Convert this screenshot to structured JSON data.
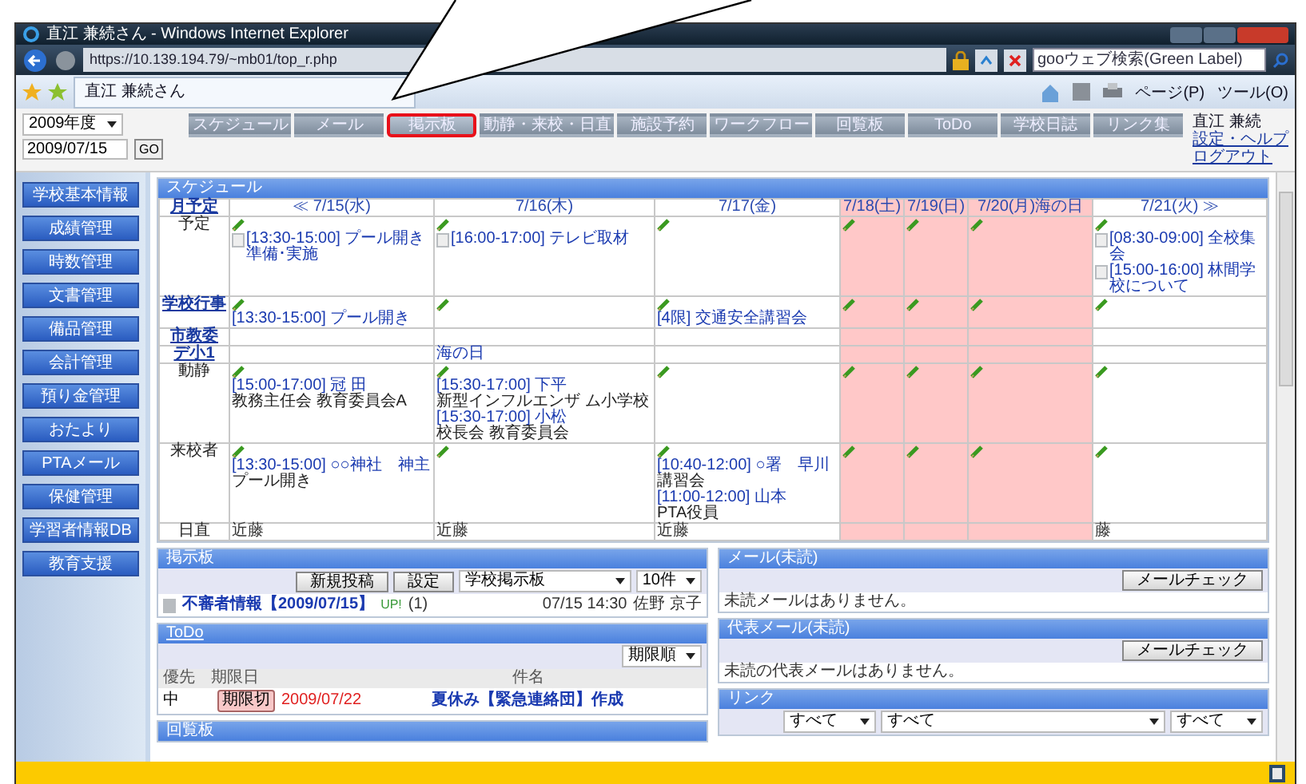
{
  "window": {
    "title": "直江 兼続さん - Windows Internet Explorer"
  },
  "address": "https://10.139.194.79/~mb01/top_r.php",
  "search": {
    "placeholder": "gooウェブ検索(Green Label)"
  },
  "tab": {
    "label": "直江 兼続さん"
  },
  "commands": [
    "ページ(P)",
    "ツール(O)"
  ],
  "year": "2009年度",
  "date": "2009/07/15",
  "go": "GO",
  "nav": [
    {
      "label": "スケジュール",
      "selected": false
    },
    {
      "label": "メール",
      "selected": false
    },
    {
      "label": "掲示板",
      "selected": true
    },
    {
      "label": "動静・来校・日直",
      "selected": false
    },
    {
      "label": "施設予約",
      "selected": false
    },
    {
      "label": "ワークフロー",
      "selected": false
    },
    {
      "label": "回覧板",
      "selected": false
    },
    {
      "label": "ToDo",
      "selected": false
    },
    {
      "label": "学校日誌",
      "selected": false
    },
    {
      "label": "リンク集",
      "selected": false
    }
  ],
  "user": {
    "name": "直江 兼続",
    "links": [
      "設定・ヘルプ",
      "ログアウト"
    ]
  },
  "sidebar": [
    "学校基本情報",
    "成績管理",
    "時数管理",
    "文書管理",
    "備品管理",
    "会計管理",
    "預り金管理",
    "おたより",
    "PTAメール",
    "保健管理",
    "学習者情報DB",
    "教育支援"
  ],
  "schedule": {
    "title": "スケジュール",
    "corner": "月予定",
    "columns": [
      {
        "label": "≪ 7/15(水)",
        "holiday": false
      },
      {
        "label": "7/16(木)",
        "holiday": false
      },
      {
        "label": "7/17(金)",
        "holiday": false
      },
      {
        "label": "7/18(土)",
        "holiday": true
      },
      {
        "label": "7/19(日)",
        "holiday": true
      },
      {
        "label": "7/20(月)海の日",
        "holiday": true
      },
      {
        "label": "7/21(火) ≫",
        "holiday": false
      }
    ],
    "rows": [
      {
        "label": "予定",
        "link": false,
        "cells": [
          {
            "pencil": true,
            "items": [
              {
                "kind": "event",
                "text": "[13:30-15:00] プール開き準備･実施"
              }
            ]
          },
          {
            "pencil": true,
            "items": [
              {
                "kind": "event",
                "text": "[16:00-17:00] テレビ取材"
              }
            ]
          },
          {
            "pencil": true
          },
          {
            "pencil": true
          },
          {
            "pencil": true
          },
          {
            "pencil": true
          },
          {
            "pencil": true,
            "items": [
              {
                "kind": "event",
                "text": "[08:30-09:00] 全校集会"
              },
              {
                "kind": "event",
                "text": "[15:00-16:00] 林間学校について"
              }
            ]
          }
        ]
      },
      {
        "label": "学校行事",
        "link": true,
        "cells": [
          {
            "pencil": true,
            "items": [
              {
                "kind": "entry",
                "text": "[13:30-15:00] プール開き"
              }
            ]
          },
          {
            "pencil": true
          },
          {
            "pencil": true,
            "items": [
              {
                "kind": "entry",
                "text": "[4限] 交通安全講習会"
              }
            ]
          },
          {
            "pencil": true
          },
          {
            "pencil": true
          },
          {
            "pencil": true
          },
          {
            "pencil": true
          }
        ]
      },
      {
        "label": "市教委",
        "link": true,
        "cells": [
          {
            "pencil": false
          },
          {
            "pencil": false
          },
          {
            "pencil": false
          },
          {
            "pencil": false
          },
          {
            "pencil": false
          },
          {
            "pencil": false
          },
          {
            "pencil": false
          }
        ]
      },
      {
        "label": "デ小1",
        "link": true,
        "cells": [
          {
            "pencil": false
          },
          {
            "pencil": false,
            "items": [
              {
                "kind": "entry",
                "text": "海の日"
              }
            ]
          },
          {
            "pencil": false
          },
          {
            "pencil": false
          },
          {
            "pencil": false
          },
          {
            "pencil": false
          },
          {
            "pencil": false
          }
        ]
      },
      {
        "label": "動静",
        "link": false,
        "cells": [
          {
            "pencil": true,
            "items": [
              {
                "kind": "entry",
                "text": "[15:00-17:00] 冠 田",
                "sub": "教務主任会 教育委員会A"
              }
            ]
          },
          {
            "pencil": true,
            "items": [
              {
                "kind": "entry",
                "text": "[15:30-17:00] 下平",
                "sub": "新型インフルエンザ ム小学校"
              },
              {
                "kind": "entry",
                "text": "[15:30-17:00] 小松",
                "sub": "校長会 教育委員会"
              }
            ]
          },
          {
            "pencil": true
          },
          {
            "pencil": true
          },
          {
            "pencil": true
          },
          {
            "pencil": true
          },
          {
            "pencil": true
          }
        ]
      },
      {
        "label": "来校者",
        "link": false,
        "cells": [
          {
            "pencil": true,
            "items": [
              {
                "kind": "entry",
                "text": "[13:30-15:00] ○○神社　神主",
                "sub": "プール開き"
              }
            ]
          },
          {
            "pencil": true
          },
          {
            "pencil": true,
            "items": [
              {
                "kind": "entry",
                "text": "[10:40-12:00] ○署　早川",
                "sub": "講習会"
              },
              {
                "kind": "entry",
                "text": "[11:00-12:00] 山本",
                "sub": "PTA役員"
              }
            ]
          },
          {
            "pencil": true
          },
          {
            "pencil": true
          },
          {
            "pencil": true
          },
          {
            "pencil": true
          }
        ]
      },
      {
        "label": "日直",
        "link": false,
        "cells": [
          {
            "pencil": false,
            "items": [
              {
                "kind": "plain",
                "text": "近藤"
              }
            ]
          },
          {
            "pencil": false,
            "items": [
              {
                "kind": "plain",
                "text": "近藤"
              }
            ]
          },
          {
            "pencil": false,
            "items": [
              {
                "kind": "plain",
                "text": "近藤"
              }
            ]
          },
          {
            "pencil": false
          },
          {
            "pencil": false
          },
          {
            "pencil": false
          },
          {
            "pencil": false,
            "items": [
              {
                "kind": "plain",
                "text": "藤"
              }
            ]
          }
        ]
      }
    ]
  },
  "board": {
    "title": "掲示板",
    "buttons": [
      "新規投稿",
      "設定"
    ],
    "select": "学校掲示板",
    "count": "10件",
    "post": {
      "title": "不審者情報【2009/07/15】",
      "badge": "UP!",
      "replies": "(1)",
      "time": "07/15 14:30",
      "author": "佐野 京子"
    }
  },
  "todo": {
    "title": "ToDo",
    "sort": "期限順",
    "columns": [
      "優先",
      "期限日",
      "件名"
    ],
    "row": {
      "priority": "中",
      "tag": "期限切",
      "date": "2009/07/22",
      "title": "夏休み【緊急連絡団】作成"
    }
  },
  "circular": {
    "title": "回覧板"
  },
  "mail": {
    "title": "メール(未読)",
    "button": "メールチェック",
    "message": "未読メールはありません。"
  },
  "rep_mail": {
    "title": "代表メール(未読)",
    "button": "メールチェック",
    "message": "未読の代表メールはありません。"
  },
  "links": {
    "title": "リンク",
    "selects": [
      "すべて",
      "すべて",
      "すべて"
    ]
  }
}
